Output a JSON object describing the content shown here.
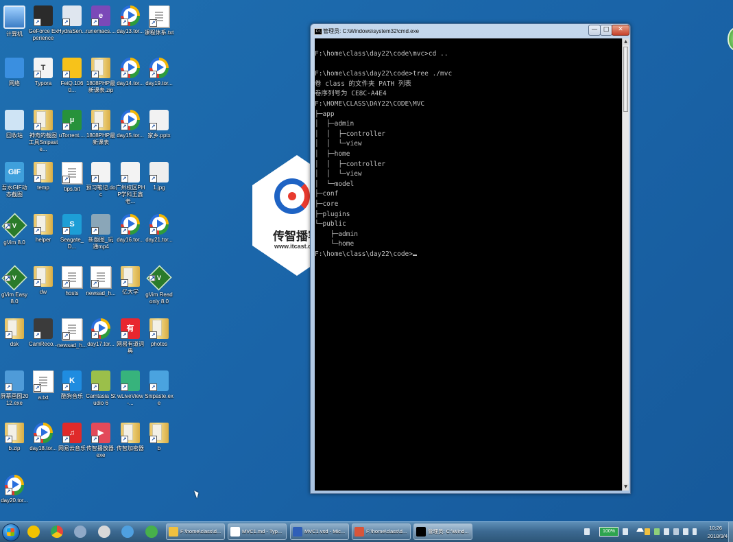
{
  "desktop": {
    "icons": [
      {
        "label": "计算机",
        "icon": "computer-icon"
      },
      {
        "label": "GeForce Experience",
        "icon": "geforce-icon"
      },
      {
        "label": "HydraSen...",
        "icon": "hydra-icon"
      },
      {
        "label": "runemacs....",
        "icon": "emacs-icon"
      },
      {
        "label": "day13.tor...",
        "icon": "torrent-icon"
      },
      {
        "label": "课程体系.txt",
        "icon": "text-file-icon"
      },
      {
        "label": "网络",
        "icon": "network-icon"
      },
      {
        "label": "Typora",
        "icon": "typora-icon"
      },
      {
        "label": "FeiQ.1060...",
        "icon": "feiq-icon"
      },
      {
        "label": "1808PHP最新课表.zip",
        "icon": "zip-icon"
      },
      {
        "label": "day14.tor...",
        "icon": "torrent-icon"
      },
      {
        "label": "day19.tor...",
        "icon": "torrent-icon"
      },
      {
        "label": "回收站",
        "icon": "recycle-bin-icon"
      },
      {
        "label": "神奇的截图工具Snipaste...",
        "icon": "folder-icon"
      },
      {
        "label": "uTorrent....",
        "icon": "utorrent-icon"
      },
      {
        "label": "1808PHP最新课表",
        "icon": "folder-icon"
      },
      {
        "label": "day15.tor...",
        "icon": "torrent-icon"
      },
      {
        "label": "家乡.pptx",
        "icon": "pptx-icon"
      },
      {
        "label": "吾水GIF动态截图",
        "icon": "gif-icon"
      },
      {
        "label": "temp",
        "icon": "folder-icon"
      },
      {
        "label": "tips.txt",
        "icon": "text-file-icon"
      },
      {
        "label": "预习笔记.doc",
        "icon": "doc-icon"
      },
      {
        "label": "广州校区PHP学科王鑫老...",
        "icon": "excel-icon"
      },
      {
        "label": "1.jpg",
        "icon": "image-icon"
      },
      {
        "label": "gVim 8.0",
        "icon": "vim-icon"
      },
      {
        "label": "helper",
        "icon": "folder-icon"
      },
      {
        "label": "Seagate_D...",
        "icon": "seagate-icon"
      },
      {
        "label": "新版图_玩通mp4",
        "icon": "video-icon"
      },
      {
        "label": "day16.tor...",
        "icon": "torrent-icon"
      },
      {
        "label": "day21.tor...",
        "icon": "torrent-icon"
      },
      {
        "label": "gVim Easy 8.0",
        "icon": "vim-icon"
      },
      {
        "label": "dw",
        "icon": "folder-icon"
      },
      {
        "label": "hosts",
        "icon": "text-file-icon"
      },
      {
        "label": "newsad_h...",
        "icon": "text-file-icon"
      },
      {
        "label": "亿大学",
        "icon": "folder-icon"
      },
      {
        "label": "gVim Read only 8.0",
        "icon": "vim-icon"
      },
      {
        "label": "dsk",
        "icon": "folder-icon"
      },
      {
        "label": "CamReco...",
        "icon": "camrec-icon"
      },
      {
        "label": "newsad_h...",
        "icon": "text-file-icon"
      },
      {
        "label": "day17.tor...",
        "icon": "torrent-icon"
      },
      {
        "label": "网易有道词典",
        "icon": "youdao-icon"
      },
      {
        "label": "photos",
        "icon": "folder-icon"
      },
      {
        "label": "屏幕画图2012.exe",
        "icon": "paint-icon"
      },
      {
        "label": "a.txt",
        "icon": "text-file-icon"
      },
      {
        "label": "酷狗音乐",
        "icon": "kugou-icon"
      },
      {
        "label": "Camtasia Studio 6",
        "icon": "camtasia-icon"
      },
      {
        "label": "wLiveView-...",
        "icon": "liveview-icon"
      },
      {
        "label": "Snipaste.exe",
        "icon": "snipaste-icon"
      },
      {
        "label": "b.zip",
        "icon": "zip-icon"
      },
      {
        "label": "day18.tor...",
        "icon": "torrent-icon"
      },
      {
        "label": "网易云音乐",
        "icon": "netease-music-icon"
      },
      {
        "label": "传智播放器.exe",
        "icon": "player-icon"
      },
      {
        "label": "传智加密器",
        "icon": "folder-icon"
      },
      {
        "label": "b",
        "icon": "folder-icon"
      },
      {
        "label": "day20.tor...",
        "icon": "torrent-icon"
      }
    ]
  },
  "watermark": {
    "cn": "传智播客",
    "en": "www.itcast.cn"
  },
  "cmd": {
    "title": "管理员: C:\\Windows\\system32\\cmd.exe",
    "icon_text": "C:\\",
    "min_label": "—",
    "max_label": "□",
    "close_label": "✕",
    "output": "F:\\home\\class\\day22\\code\\mvc>cd ..\n\nF:\\home\\class\\day22\\code>tree ./mvc\n卷 class 的文件夹 PATH 列表\n卷序列号为 CE8C-A4E4\nF:\\HOME\\CLASS\\DAY22\\CODE\\MVC\n├─app\n│  ├─admin\n│  │  ├─controller\n│  │  └─view\n│  ├─home\n│  │  ├─controller\n│  │  └─view\n│  └─model\n├─conf\n├─core\n├─plugins\n└─public\n    ├─admin\n    └─home\n",
    "prompt": "F:\\home\\class\\day22\\code>"
  },
  "taskbar": {
    "pinned": [
      "media-player-icon",
      "chrome-icon",
      "virtualbox-icon",
      "calculator-icon",
      "network-tool-icon",
      "360-icon"
    ],
    "tasks": [
      {
        "label": "F:\\home\\class\\d...",
        "icon": "folder-icon",
        "color": "#f0c040"
      },
      {
        "label": "MVC1.md - Typ...",
        "icon": "typora-icon",
        "color": "#ffffff"
      },
      {
        "label": "MVC1.vsd - Mic...",
        "icon": "visio-icon",
        "color": "#2f5fb8"
      },
      {
        "label": "F:\\home\\class\\d...",
        "icon": "paint-icon",
        "color": "#d8553a"
      },
      {
        "label": "管理员: C:\\Wind...",
        "icon": "cmd-icon",
        "color": "#000000"
      }
    ],
    "battery": "100%",
    "time": "10:26",
    "date": "2018/9/4"
  }
}
